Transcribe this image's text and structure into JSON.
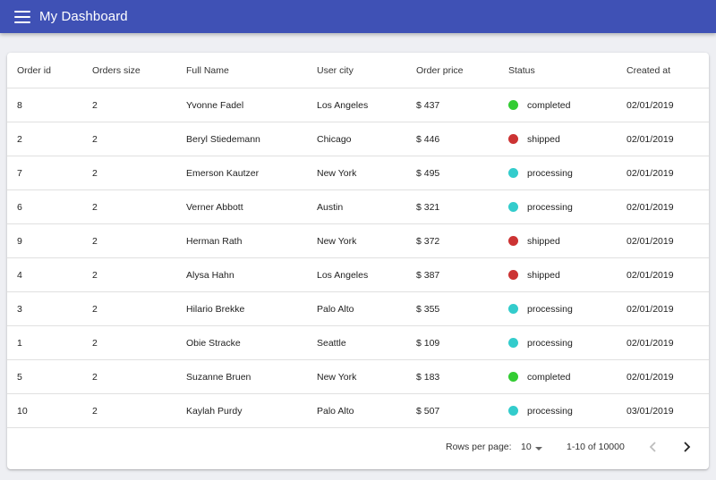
{
  "app": {
    "title": "My Dashboard"
  },
  "table": {
    "headers": {
      "order_id": "Order id",
      "orders_size": "Orders size",
      "full_name": "Full Name",
      "user_city": "User city",
      "order_price": "Order price",
      "status": "Status",
      "created_at": "Created at"
    },
    "rows": [
      {
        "order_id": "8",
        "orders_size": "2",
        "full_name": "Yvonne Fadel",
        "user_city": "Los Angeles",
        "order_price": "$ 437",
        "status": "completed",
        "created_at": "02/01/2019"
      },
      {
        "order_id": "2",
        "orders_size": "2",
        "full_name": "Beryl Stiedemann",
        "user_city": "Chicago",
        "order_price": "$ 446",
        "status": "shipped",
        "created_at": "02/01/2019"
      },
      {
        "order_id": "7",
        "orders_size": "2",
        "full_name": "Emerson Kautzer",
        "user_city": "New York",
        "order_price": "$ 495",
        "status": "processing",
        "created_at": "02/01/2019"
      },
      {
        "order_id": "6",
        "orders_size": "2",
        "full_name": "Verner Abbott",
        "user_city": "Austin",
        "order_price": "$ 321",
        "status": "processing",
        "created_at": "02/01/2019"
      },
      {
        "order_id": "9",
        "orders_size": "2",
        "full_name": "Herman Rath",
        "user_city": "New York",
        "order_price": "$ 372",
        "status": "shipped",
        "created_at": "02/01/2019"
      },
      {
        "order_id": "4",
        "orders_size": "2",
        "full_name": "Alysa Hahn",
        "user_city": "Los Angeles",
        "order_price": "$ 387",
        "status": "shipped",
        "created_at": "02/01/2019"
      },
      {
        "order_id": "3",
        "orders_size": "2",
        "full_name": "Hilario Brekke",
        "user_city": "Palo Alto",
        "order_price": "$ 355",
        "status": "processing",
        "created_at": "02/01/2019"
      },
      {
        "order_id": "1",
        "orders_size": "2",
        "full_name": "Obie Stracke",
        "user_city": "Seattle",
        "order_price": "$ 109",
        "status": "processing",
        "created_at": "02/01/2019"
      },
      {
        "order_id": "5",
        "orders_size": "2",
        "full_name": "Suzanne Bruen",
        "user_city": "New York",
        "order_price": "$ 183",
        "status": "completed",
        "created_at": "02/01/2019"
      },
      {
        "order_id": "10",
        "orders_size": "2",
        "full_name": "Kaylah Purdy",
        "user_city": "Palo Alto",
        "order_price": "$ 507",
        "status": "processing",
        "created_at": "03/01/2019"
      }
    ]
  },
  "status_colors": {
    "completed": "#33cc33",
    "shipped": "#cc3333",
    "processing": "#33cccc"
  },
  "pagination": {
    "rows_per_page_label": "Rows per page:",
    "rows_per_page_value": "10",
    "range_text": "1-10 of 10000",
    "prev_icon": "chevron-left-icon",
    "next_icon": "chevron-right-icon"
  },
  "colors": {
    "appbar": "#3f51b5",
    "background": "#eeeff3"
  }
}
